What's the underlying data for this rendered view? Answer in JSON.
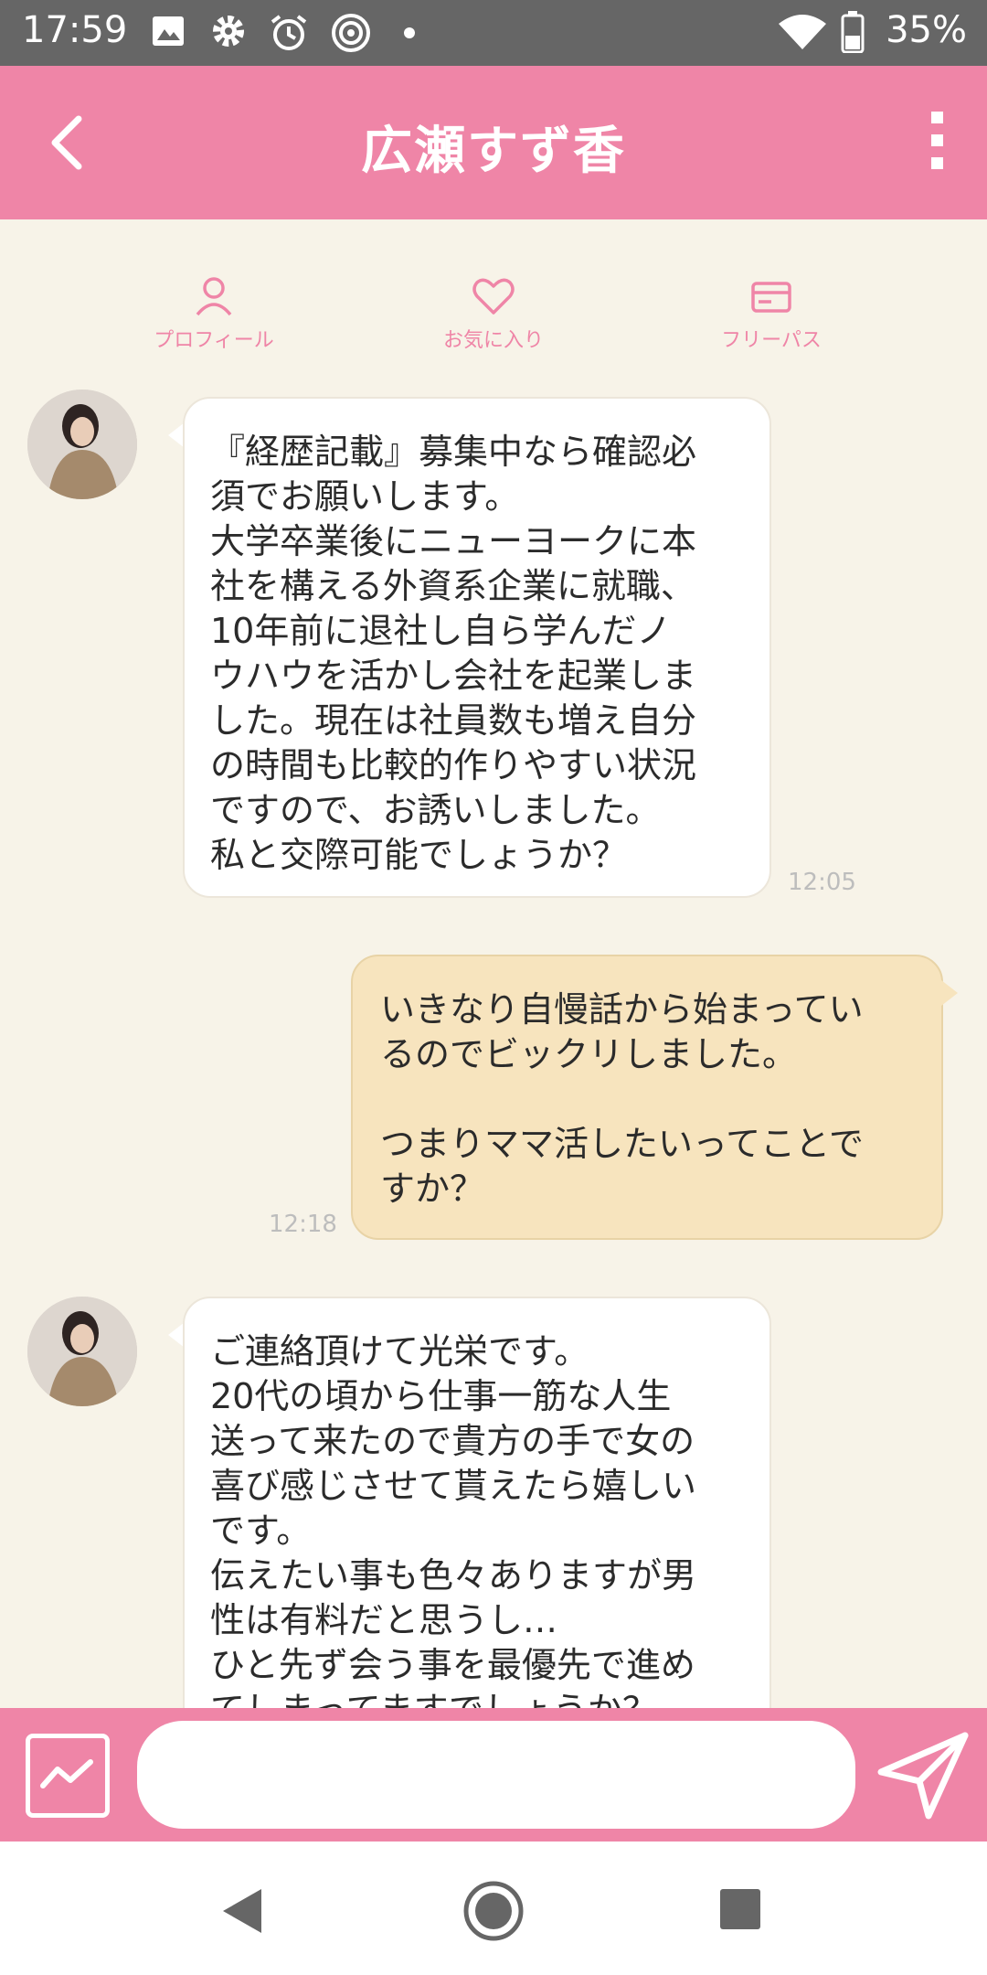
{
  "status_bar": {
    "time": "17:59",
    "battery": "35%"
  },
  "header": {
    "title": "広瀬すず香"
  },
  "quick_actions": [
    {
      "label": "プロフィール",
      "icon": "person-icon"
    },
    {
      "label": "お気に入り",
      "icon": "heart-icon"
    },
    {
      "label": "フリーパス",
      "icon": "card-icon"
    }
  ],
  "messages": [
    {
      "direction": "incoming",
      "text": "『経歴記載』募集中なら確認必\n須でお願いします。\n大学卒業後にニューヨークに本\n社を構える外資系企業に就職、\n10年前に退社し自ら学んだノ\nウハウを活かし会社を起業しま\nした。現在は社員数も増え自分\nの時間も比較的作りやすい状況\nですので、お誘いしました。\n私と交際可能でしょうか？",
      "time": "12:05"
    },
    {
      "direction": "outgoing",
      "text": "いきなり自慢話から始まってい\nるのでビックリしました。\n\nつまりママ活したいってことで\nすか？",
      "time": "12:18"
    },
    {
      "direction": "incoming",
      "text": "ご連絡頂けて光栄です。\n20代の頃から仕事一筋な人生\n送って来たので貴方の手で女の\n喜び感じさせて貰えたら嬉しい\nです。\n伝えたい事も色々ありますが男\n性は有料だと思うし…\nひと先ず会う事を最優先で進め\nてしまってますでしょうか？"
    }
  ],
  "composer": {
    "placeholder": ""
  },
  "colors": {
    "accent": "#ef85a7",
    "background": "#f7f3e8",
    "outgoing_bubble": "#f7e4be",
    "status_bar": "#666666"
  }
}
